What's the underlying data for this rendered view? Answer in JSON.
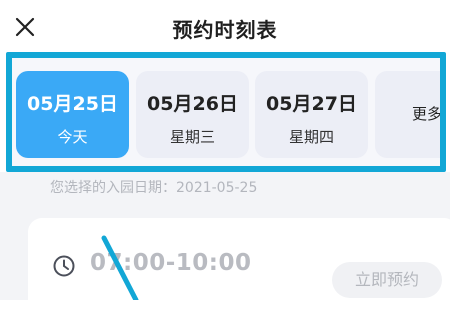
{
  "header": {
    "title": "预约时刻表",
    "close_icon": "close-icon"
  },
  "date_selector": {
    "dates": [
      {
        "date": "05月25日",
        "weekday": "今天",
        "selected": true
      },
      {
        "date": "05月26日",
        "weekday": "星期三",
        "selected": false
      },
      {
        "date": "05月27日",
        "weekday": "星期四",
        "selected": false
      }
    ],
    "more_label": "更多>",
    "highlight_color": "#12a7d6",
    "selected_color": "#3aa9f6"
  },
  "selected_date_text": "您选择的入园日期：2021-05-25",
  "slots": [
    {
      "time": "07:00-10:00",
      "action_label": "立即预约",
      "icon": "clock-icon"
    }
  ]
}
